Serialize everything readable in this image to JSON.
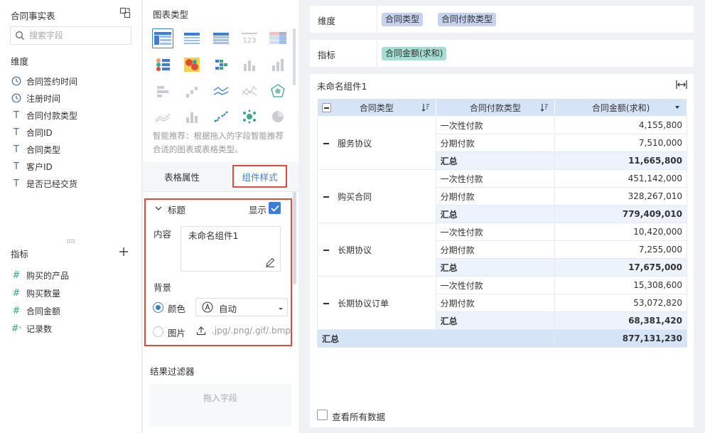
{
  "left_panel": {
    "dataset_title": "合同事实表",
    "search_placeholder": "搜索字段",
    "dimension_header": "维度",
    "dimensions": [
      {
        "label": "合同签约时间",
        "icon": "clock-icon"
      },
      {
        "label": "注册时间",
        "icon": "clock-icon"
      },
      {
        "label": "合同付款类型",
        "icon": "text-type-icon"
      },
      {
        "label": "合同ID",
        "icon": "text-type-icon"
      },
      {
        "label": "合同类型",
        "icon": "text-type-icon"
      },
      {
        "label": "客户ID",
        "icon": "text-type-icon"
      },
      {
        "label": "是否已经交货",
        "icon": "text-type-icon"
      }
    ],
    "measure_header": "指标",
    "measures": [
      {
        "label": "购买的产品",
        "icon": "number-type-icon"
      },
      {
        "label": "购买数量",
        "icon": "number-type-icon"
      },
      {
        "label": "合同金额",
        "icon": "number-type-icon"
      },
      {
        "label": "记录数",
        "icon": "record-count-icon"
      }
    ]
  },
  "middle_panel": {
    "chart_type_title": "图表类型",
    "recommend_text": "智能推荐：根据拖入的字段智能推荐合适的图表或表格类型。",
    "tab_table_props": "表格属性",
    "tab_component_style": "组件样式",
    "title_section": "标题",
    "show_label": "显示",
    "content_label": "内容",
    "content_value": "未命名组件1",
    "background_label": "背景",
    "color_option": "颜色",
    "color_select_value": "自动",
    "image_option": "图片",
    "upload_hint": ".jpg/.png/.gif/.bmp",
    "result_filter_title": "结果过滤器",
    "drop_hint": "拖入字段"
  },
  "right_panel": {
    "dimension_label": "维度",
    "dimension_pills": [
      "合同类型",
      "合同付款类型"
    ],
    "measure_label": "指标",
    "measure_pills": [
      "合同金额(求和)"
    ],
    "component_title": "未命名组件1",
    "table": {
      "headers": [
        "合同类型",
        "合同付款类型",
        "合同金额(求和)"
      ],
      "groups": [
        {
          "name": "服务协议",
          "rows": [
            [
              "一次性付款",
              "4,155,800"
            ],
            [
              "分期付款",
              "7,510,000"
            ]
          ],
          "subtotal_label": "汇总",
          "subtotal": "11,665,800"
        },
        {
          "name": "购买合同",
          "rows": [
            [
              "一次性付款",
              "451,142,000"
            ],
            [
              "分期付款",
              "328,267,010"
            ]
          ],
          "subtotal_label": "汇总",
          "subtotal": "779,409,010"
        },
        {
          "name": "长期协议",
          "rows": [
            [
              "一次性付款",
              "10,420,000"
            ],
            [
              "分期付款",
              "7,255,000"
            ]
          ],
          "subtotal_label": "汇总",
          "subtotal": "17,675,000"
        },
        {
          "name": "长期协议订单",
          "rows": [
            [
              "一次性付款",
              "15,308,600"
            ],
            [
              "分期付款",
              "53,072,820"
            ]
          ],
          "subtotal_label": "汇总",
          "subtotal": "68,381,420"
        }
      ],
      "total_label": "汇总",
      "total": "877,131,230"
    },
    "view_all_label": "查看所有数据"
  },
  "colors": {
    "accent": "#3d7cd9",
    "highlight_border": "#e14b3b",
    "header_bg": "#d6e4f7",
    "dimension_pill": "#c5d3ee",
    "measure_pill": "#a7ded3"
  }
}
